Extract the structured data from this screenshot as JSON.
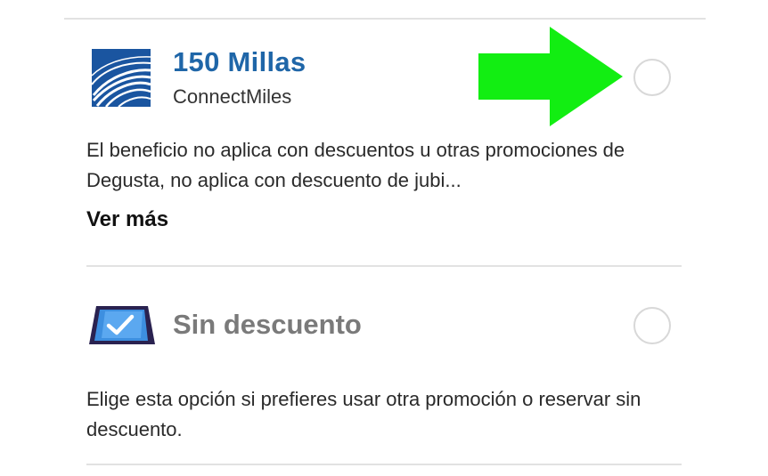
{
  "options": [
    {
      "title": "150 Millas",
      "subtitle": "ConnectMiles",
      "description": "El beneficio no aplica con descuentos u otras promociones de Degusta, no aplica con descuento de jubi...",
      "more_label": "Ver más",
      "logo_icon": "connectmiles-logo-icon",
      "selected": false
    },
    {
      "title": "Sin descuento",
      "description": "Elige esta opción si prefieres usar otra promoción o reservar sin descuento.",
      "card_icon": "checkmark-card-icon",
      "selected": false
    }
  ],
  "colors": {
    "title_blue": "#1f66a8",
    "logo_blue": "#1a55a0",
    "arrow_green": "#12ee12",
    "muted_title": "#7a7a7a",
    "divider": "#e2e2e2"
  }
}
